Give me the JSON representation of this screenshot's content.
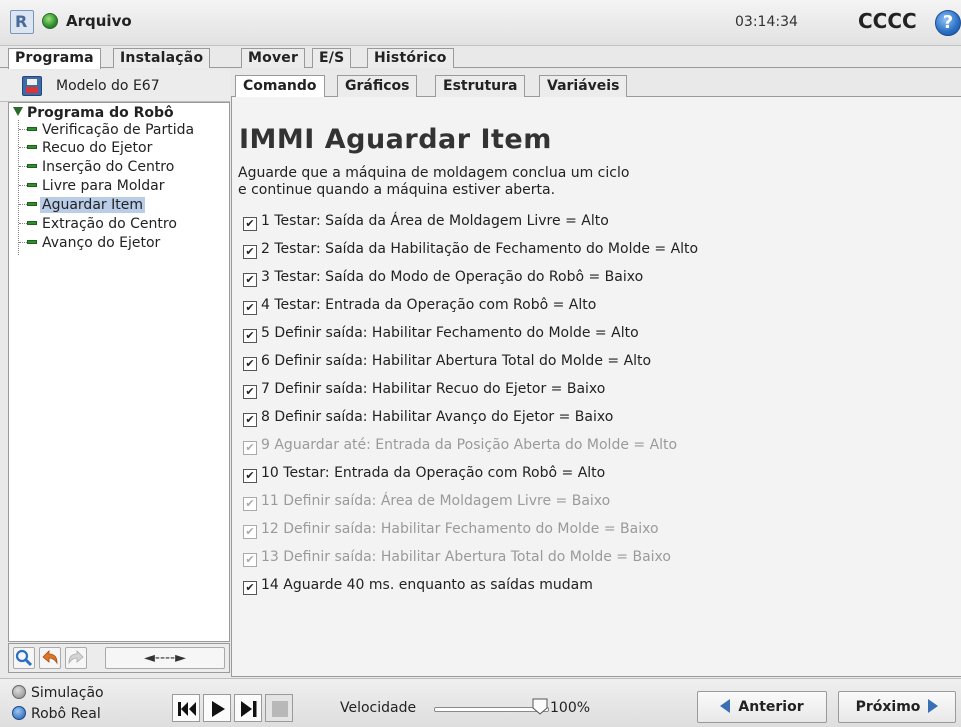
{
  "titlebar": {
    "app_name": "Arquivo",
    "clock": "03:14:34",
    "robot_name": "CCCC",
    "help_glyph": "?"
  },
  "main_tabs": [
    {
      "label": "Programa",
      "active": true
    },
    {
      "label": "Instalação",
      "active": false
    },
    {
      "label": "Mover",
      "active": false
    },
    {
      "label": "E/S",
      "active": false
    },
    {
      "label": "Histórico",
      "active": false
    }
  ],
  "left_panel": {
    "model_label": "Modelo do E67",
    "tree": {
      "root": "Programa do Robô",
      "items": [
        {
          "label": "Verificação de Partida",
          "selected": false
        },
        {
          "label": "Recuo do Ejetor",
          "selected": false
        },
        {
          "label": "Inserção do Centro",
          "selected": false
        },
        {
          "label": "Livre para Moldar",
          "selected": false
        },
        {
          "label": "Aguardar Item",
          "selected": true
        },
        {
          "label": "Extração do Centro",
          "selected": false
        },
        {
          "label": "Avanço do Ejetor",
          "selected": false
        }
      ]
    },
    "toolbar": {
      "icons": [
        "search-icon",
        "undo-icon",
        "redo-icon"
      ],
      "move_label": "◄----►"
    }
  },
  "sub_tabs": [
    {
      "label": "Comando",
      "active": true
    },
    {
      "label": "Gráficos",
      "active": false
    },
    {
      "label": "Estrutura",
      "active": false
    },
    {
      "label": "Variáveis",
      "active": false
    }
  ],
  "command": {
    "title": "IMMI Aguardar Item",
    "description_line1": "Aguarde que a máquina de moldagem conclua um ciclo",
    "description_line2": "e continue quando a máquina estiver aberta.",
    "checks": [
      {
        "text": "1 Testar: Saída da Área de Moldagem Livre = Alto",
        "checked": true,
        "enabled": true
      },
      {
        "text": "2 Testar: Saída da Habilitação de Fechamento do Molde = Alto",
        "checked": true,
        "enabled": true
      },
      {
        "text": "3 Testar: Saída do Modo de Operação do Robô = Baixo",
        "checked": true,
        "enabled": true
      },
      {
        "text": "4 Testar: Entrada da Operação com Robô = Alto",
        "checked": true,
        "enabled": true
      },
      {
        "text": "5 Definir saída: Habilitar Fechamento do Molde = Alto",
        "checked": true,
        "enabled": true
      },
      {
        "text": "6 Definir saída: Habilitar Abertura Total do Molde = Alto",
        "checked": true,
        "enabled": true
      },
      {
        "text": "7 Definir saída: Habilitar Recuo do Ejetor = Baixo",
        "checked": true,
        "enabled": true
      },
      {
        "text": "8 Definir saída: Habilitar Avanço do Ejetor = Baixo",
        "checked": true,
        "enabled": true
      },
      {
        "text": "9 Aguardar até: Entrada da Posição Aberta do Molde = Alto",
        "checked": true,
        "enabled": false
      },
      {
        "text": "10 Testar: Entrada da Operação com Robô = Alto",
        "checked": true,
        "enabled": true
      },
      {
        "text": "11 Definir saída: Área de Moldagem Livre = Baixo",
        "checked": true,
        "enabled": false
      },
      {
        "text": "12 Definir saída: Habilitar Fechamento do Molde = Baixo",
        "checked": true,
        "enabled": false
      },
      {
        "text": "13 Definir saída: Habilitar Abertura Total do Molde = Baixo",
        "checked": true,
        "enabled": false
      },
      {
        "text": "14 Aguarde 40 ms. enquanto as saídas mudam",
        "checked": true,
        "enabled": true
      }
    ]
  },
  "footer": {
    "simulation_label": "Simulação",
    "real_robot_label": "Robô Real",
    "simulation_selected": false,
    "real_robot_selected": true,
    "speed_label": "Velocidade",
    "speed_value": "100%",
    "speed_fraction": 1.0,
    "prev_label": "Anterior",
    "next_label": "Próximo"
  },
  "colors": {
    "accent": "#3a6fb5",
    "selection": "#b9cde8",
    "node_green": "#2e8f2e",
    "disabled_text": "#9a9a9a"
  }
}
